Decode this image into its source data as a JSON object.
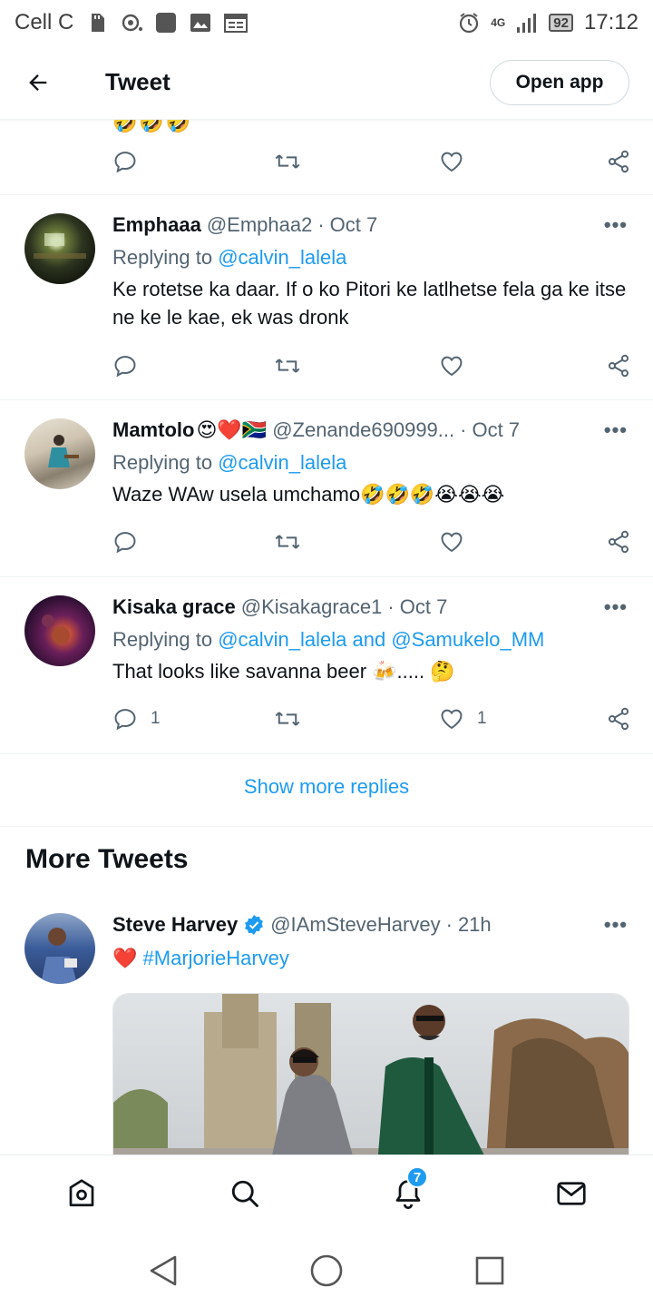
{
  "status_bar": {
    "carrier": "Cell C",
    "network": "4G",
    "battery": "92",
    "time": "17:12"
  },
  "header": {
    "title": "Tweet",
    "open_app_label": "Open app"
  },
  "partial_top": {
    "emoji": "🤣🤣🤣"
  },
  "tweets": [
    {
      "name": "Emphaaa",
      "handle": "@Emphaa2",
      "time": "Oct 7",
      "replying_prefix": "Replying to",
      "replying_to": "@calvin_lalela",
      "text": "Ke rotetse ka daar. If o ko Pitori ke latlhetse fela ga ke itse ne ke le kae, ek was dronk",
      "reply_count": "",
      "like_count": ""
    },
    {
      "name": "Mamtolo",
      "name_emoji": "😍❤️🇿🇦",
      "handle": "@Zenande690999...",
      "time": "Oct 7",
      "replying_prefix": "Replying to",
      "replying_to": "@calvin_lalela",
      "text": "Waze WAw usela umchamo🤣🤣🤣😭😭😭",
      "reply_count": "",
      "like_count": ""
    },
    {
      "name": "Kisaka grace",
      "handle": "@Kisakagrace1",
      "time": "Oct 7",
      "replying_prefix": "Replying to",
      "replying_to": "@calvin_lalela and @Samukelo_MM",
      "text": "That looks like savanna beer 🍻..... 🤔",
      "reply_count": "1",
      "like_count": "1"
    }
  ],
  "show_more_replies": "Show more replies",
  "more_tweets": {
    "title": "More Tweets",
    "tweet": {
      "name": "Steve Harvey",
      "handle": "@IAmSteveHarvey",
      "time": "21h",
      "heart": "❤️",
      "hashtag": "#MarjorieHarvey"
    }
  },
  "bottom_nav": {
    "notification_count": "7"
  },
  "colors": {
    "accent": "#1d9bf0",
    "text_primary": "#0f1419",
    "text_secondary": "#536471"
  }
}
